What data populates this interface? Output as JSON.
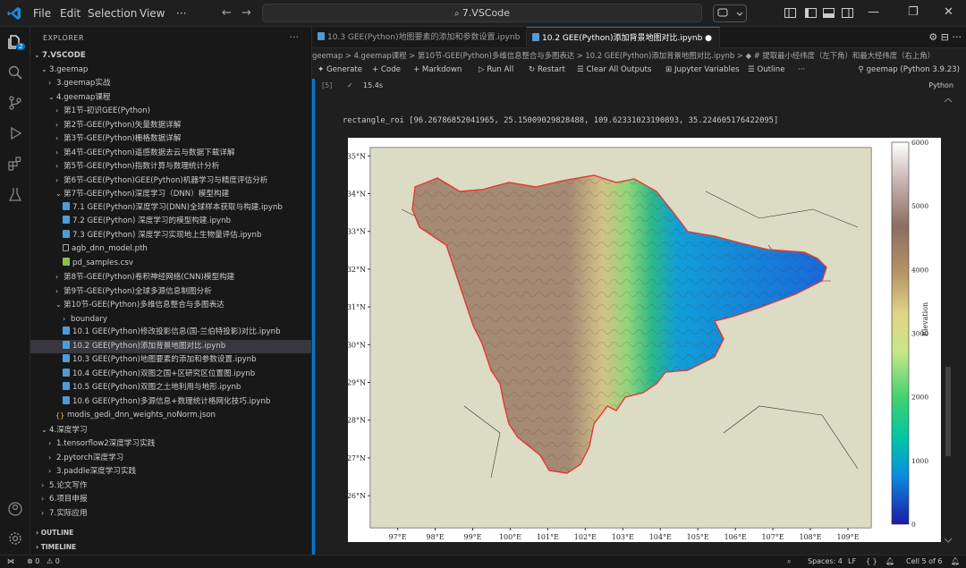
{
  "menu": {
    "file": "File",
    "edit": "Edit",
    "selection": "Selection",
    "view": "View",
    "more": "···"
  },
  "command_center": "7.VSCode",
  "explorer": {
    "title": "EXPLORER",
    "more": "···",
    "badge": "2"
  },
  "tree": [
    {
      "label": "7.VSCODE",
      "indent": 0,
      "chev": "⌄",
      "bold": true
    },
    {
      "label": "3.geemap",
      "indent": 1,
      "chev": "⌄"
    },
    {
      "label": "3.geemap实战",
      "indent": 2,
      "chev": "›"
    },
    {
      "label": "4.geemap课程",
      "indent": 2,
      "chev": "⌄"
    },
    {
      "label": "第1节-初识GEE(Python)",
      "indent": 3,
      "chev": "›"
    },
    {
      "label": "第2节-GEE(Python)矢量数据详解",
      "indent": 3,
      "chev": "›"
    },
    {
      "label": "第3节-GEE(Python)栅格数据详解",
      "indent": 3,
      "chev": "›"
    },
    {
      "label": "第4节-GEE(Python)遥感数据去云与数据下载详解",
      "indent": 3,
      "chev": "›"
    },
    {
      "label": "第5节-GEE(Python)指数计算与数理统计分析",
      "indent": 3,
      "chev": "›"
    },
    {
      "label": "第6节-GEE(Python)GEE(Python)机器学习与精度评估分析",
      "indent": 3,
      "chev": "›"
    },
    {
      "label": "第7节-GEE(Python)深度学习（DNN）模型构建",
      "indent": 3,
      "chev": "⌄"
    },
    {
      "label": "7.1 GEE(Python)深度学习(DNN)全球样本获取与构建.ipynb",
      "indent": 4,
      "icon": "nb"
    },
    {
      "label": "7.2 GEE(Python) 深度学习的模型构建.ipynb",
      "indent": 4,
      "icon": "nb"
    },
    {
      "label": "7.3 GEE(Python) 深度学习实现地上生物量评估.ipynb",
      "indent": 4,
      "icon": "nb"
    },
    {
      "label": "agb_dnn_model.pth",
      "indent": 4,
      "icon": "pth"
    },
    {
      "label": "pd_samples.csv",
      "indent": 4,
      "icon": "csv"
    },
    {
      "label": "第8节-GEE(Python)卷积神经网络(CNN)模型构建",
      "indent": 3,
      "chev": "›"
    },
    {
      "label": "第9节-GEE(Python)全球多源信息制图分析",
      "indent": 3,
      "chev": "›"
    },
    {
      "label": "第10节-GEE(Python)多维信息整合与多图表达",
      "indent": 3,
      "chev": "⌄"
    },
    {
      "label": "boundary",
      "indent": 4,
      "chev": "›"
    },
    {
      "label": "10.1 GEE(Python)修改投影信息(国-兰伯特投影)对比.ipynb",
      "indent": 4,
      "icon": "nb"
    },
    {
      "label": "10.2 GEE(Python)添加背景地图对比.ipynb",
      "indent": 4,
      "icon": "nb",
      "selected": true
    },
    {
      "label": "10.3 GEE(Python)地图要素的添加和参数设置.ipynb",
      "indent": 4,
      "icon": "nb"
    },
    {
      "label": "10.4 GEE(Python)双图之国+区研究区位置图.ipynb",
      "indent": 4,
      "icon": "nb"
    },
    {
      "label": "10.5 GEE(Python)双图之土地利用与地形.ipynb",
      "indent": 4,
      "icon": "nb"
    },
    {
      "label": "10.6 GEE(Python)多源信息+数理统计格网化技巧.ipynb",
      "indent": 4,
      "icon": "nb"
    },
    {
      "label": "modis_gedi_dnn_weights_noNorm.json",
      "indent": 3,
      "icon": "json"
    },
    {
      "label": "4.深度学习",
      "indent": 1,
      "chev": "⌄"
    },
    {
      "label": "1.tensorflow2深度学习实践",
      "indent": 2,
      "chev": "›"
    },
    {
      "label": "2.pytorch深度学习",
      "indent": 2,
      "chev": "›"
    },
    {
      "label": "3.paddle深度学习实践",
      "indent": 2,
      "chev": "›"
    },
    {
      "label": "5.论文写作",
      "indent": 1,
      "chev": "›"
    },
    {
      "label": "6.项目申报",
      "indent": 1,
      "chev": "›"
    },
    {
      "label": "7.实际应用",
      "indent": 1,
      "chev": "›"
    }
  ],
  "panels": {
    "outline": "OUTLINE",
    "timeline": "TIMELINE"
  },
  "tabs": [
    {
      "label": "10.3 GEE(Python)地图要素的添加和参数设置.ipynb",
      "active": false
    },
    {
      "label": "10.2 GEE(Python)添加背景地图对比.ipynb",
      "active": true,
      "dirty": "●"
    }
  ],
  "breadcrumb": "geemap > 4.geemap课程 > 第10节-GEE(Python)多维信息整合与多图表达 > 10.2 GEE(Python)添加背景地图对比.ipynb > ◆ # 提取最小经纬度（左下角）和最大经纬度（右上角）",
  "toolbar": {
    "generate": "Generate",
    "code": "+ Code",
    "markdown": "+ Markdown",
    "run_all": "Run All",
    "restart": "Restart",
    "clear": "Clear All Outputs",
    "variables": "Jupyter Variables",
    "outline": "Outline",
    "more": "···",
    "kernel": "geemap (Python 3.9.23)"
  },
  "cell": {
    "exec_count": "[5]",
    "check": "✓",
    "elapsed": "15.4s",
    "language": "Python"
  },
  "output_text": "rectangle_roi [96.26786852041965, 25.15009029828488, 109.62331023190893, 35.224605176422095]",
  "chart_data": {
    "type": "heatmap",
    "title": "",
    "colorbar_label": "Elevation",
    "colorbar_ticks": [
      0,
      1000,
      2000,
      3000,
      4000,
      5000,
      6000
    ],
    "xticks": [
      "97°E",
      "98°E",
      "99°E",
      "100°E",
      "101°E",
      "102°E",
      "103°E",
      "104°E",
      "105°E",
      "106°E",
      "107°E",
      "108°E",
      "109°E"
    ],
    "yticks": [
      "26°N",
      "27°N",
      "28°N",
      "29°N",
      "30°N",
      "31°N",
      "32°N",
      "33°N",
      "34°N",
      "35°N"
    ],
    "xlim": [
      96.27,
      109.62
    ],
    "ylim": [
      25.15,
      35.22
    ],
    "colormap": "terrain",
    "boundary_color": "#e53935"
  },
  "status": {
    "errors": "⊗ 0",
    "warnings": "⚠ 0",
    "spaces": "Spaces: 4",
    "eol": "LF",
    "braces": "{ }",
    "cell": "Cell 5 of 6"
  }
}
